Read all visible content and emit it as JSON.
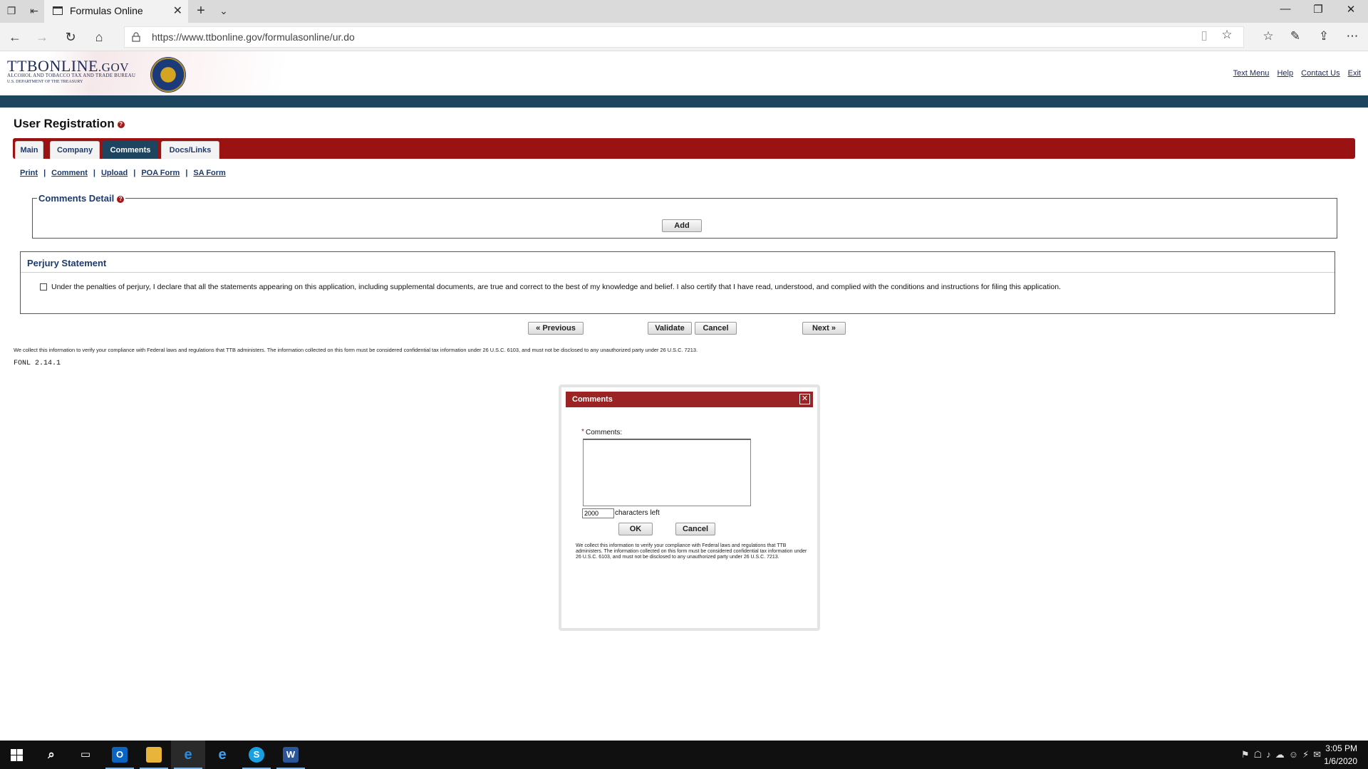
{
  "browser": {
    "tab_title": "Formulas Online",
    "url": "https://www.ttbonline.gov/formulasonline/ur.do"
  },
  "site": {
    "logo_main": "TTBONLINE",
    "logo_gov": ".GOV",
    "logo_sub1": "ALCOHOL AND TOBACCO TAX AND TRADE BUREAU",
    "logo_sub2": "U.S. DEPARTMENT OF THE TREASURY",
    "header_links": [
      "Text Menu",
      "Help",
      "Contact Us",
      "Exit"
    ]
  },
  "page": {
    "title": "User Registration",
    "tabs": [
      {
        "label": "Main"
      },
      {
        "label": "Company"
      },
      {
        "label": "Comments",
        "active": true
      },
      {
        "label": "Docs/Links"
      }
    ],
    "action_links": [
      "Print",
      "Comment",
      "Upload",
      "POA Form",
      "SA Form"
    ],
    "comments_detail": {
      "legend": "Comments Detail",
      "add_label": "Add"
    },
    "perjury": {
      "title": "Perjury Statement",
      "text": "Under the penalties of perjury, I declare that all the statements appearing on this application, including supplemental documents, are true and correct to the best of my knowledge and belief. I also certify that I have read, understood, and complied with the conditions and instructions for filing this application.",
      "checked": false
    },
    "nav_buttons": {
      "previous": "« Previous",
      "validate": "Validate",
      "cancel": "Cancel",
      "next": "Next »"
    },
    "disclaimer": "We collect this information to verify your compliance with Federal laws and regulations that TTB administers. The information collected on this form must be considered confidential tax information under 26 U.S.C. 6103, and must not be disclosed to any unauthorized party under 26 U.S.C. 7213.",
    "version": "FONL 2.14.1"
  },
  "modal": {
    "title": "Comments",
    "close_glyph": "✕",
    "comments_label": "Comments:",
    "comments_value": "",
    "chars_left_value": "2000",
    "chars_left_label": "characters left",
    "ok_label": "OK",
    "cancel_label": "Cancel",
    "disclaimer": "We collect this information to verify your compliance with Federal laws and regulations that TTB administers. The information collected on this form must be considered confidential tax information under 26 U.S.C. 6103, and must not be disclosed to any unauthorized party under 26 U.S.C. 7213."
  },
  "taskbar": {
    "apps": [
      "outlook-icon",
      "file-explorer-icon",
      "edge-icon",
      "internet-explorer-icon",
      "skype-icon",
      "word-icon"
    ],
    "time": "3:05 PM",
    "date": "1/6/2020"
  },
  "colors": {
    "tab_strip_red": "#9b1212",
    "navy_band": "#1d4560",
    "link_blue": "#1d3a6e",
    "modal_header": "#9b2323"
  }
}
